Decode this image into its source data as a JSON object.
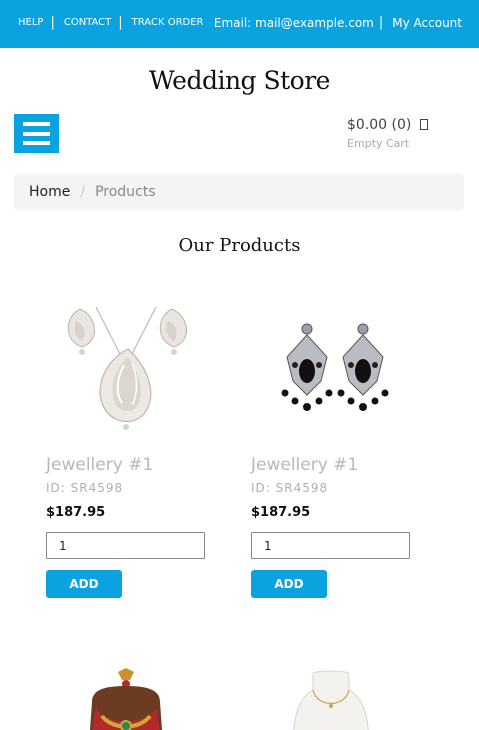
{
  "topbar": {
    "help": "HELP",
    "contact": "CONTACT",
    "track_order": "TRACK ORDER",
    "email": "Email: mail@example.com",
    "my_account": "My Account",
    "background_color": "#0aa3e0"
  },
  "store": {
    "name": "Wedding Store"
  },
  "menu": {
    "icon": "hamburger-menu-icon"
  },
  "cart": {
    "amount": "$0.00 (0)",
    "status": "Empty Cart",
    "icon": "cart-icon"
  },
  "breadcrumb": {
    "home": "Home",
    "separator": "/",
    "current": "Products"
  },
  "main": {
    "title": "Our Products"
  },
  "products": [
    {
      "name": "Jewellery #1",
      "sku": "ID: SR4598",
      "price": "$187.95",
      "quantity": "1",
      "add_label": "ADD",
      "image": "diamond-pendant-earring-set"
    },
    {
      "name": "Jewellery #1",
      "sku": "ID: SR4598",
      "price": "$187.95",
      "quantity": "1",
      "add_label": "ADD",
      "image": "black-stone-chandelier-earrings"
    }
  ],
  "more_products": [
    {
      "image": "bridal-kundan-necklace-set"
    },
    {
      "image": "gold-chain-necklace-on-bust"
    }
  ],
  "colors": {
    "accent": "#0aa3e0",
    "muted_text": "#b8b8b8"
  }
}
